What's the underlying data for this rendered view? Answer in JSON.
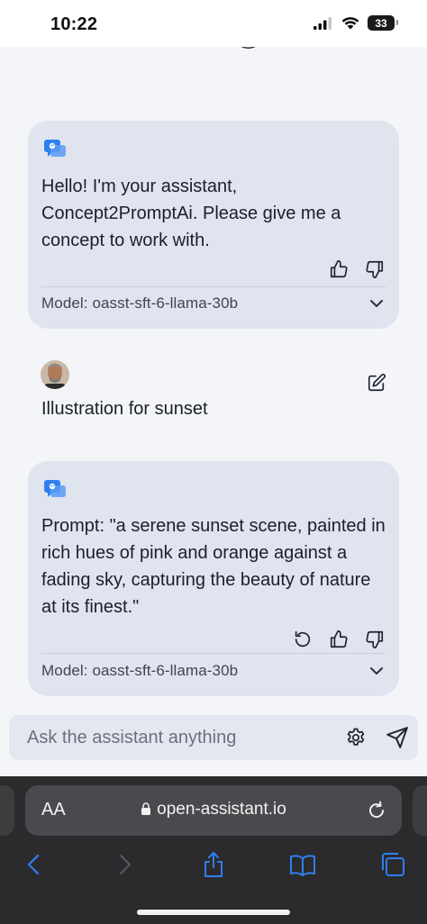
{
  "status_bar": {
    "time": "10:22",
    "battery": "33"
  },
  "chat": {
    "messages": [
      {
        "role": "assistant",
        "text": "Hello! I'm your assistant, Concept2PromptAi. Please give me a concept to work with.",
        "model": "Model: oasst-sft-6-llama-30b"
      },
      {
        "role": "user",
        "text": "Illustration for sunset"
      },
      {
        "role": "assistant",
        "text": "Prompt: \"a serene sunset scene, painted in rich hues of pink and orange against a fading sky, capturing the beauty of nature at its finest.\"",
        "model": "Model: oasst-sft-6-llama-30b"
      }
    ]
  },
  "input": {
    "placeholder": "Ask the assistant anything"
  },
  "browser": {
    "text_size_label": "AA",
    "url": "open-assistant.io"
  },
  "colors": {
    "bubble": "#dfe4ef",
    "background": "#f4f5f8",
    "accent": "#2f7ff0",
    "safari_bar": "#2b2b2d"
  },
  "icons": [
    "bot-icon",
    "thumbs-up-icon",
    "thumbs-down-icon",
    "chevron-down-icon",
    "edit-icon",
    "retry-icon",
    "gear-icon",
    "send-icon",
    "lock-icon",
    "reload-icon",
    "back-icon",
    "forward-icon",
    "share-icon",
    "bookmarks-icon",
    "tabs-icon"
  ]
}
